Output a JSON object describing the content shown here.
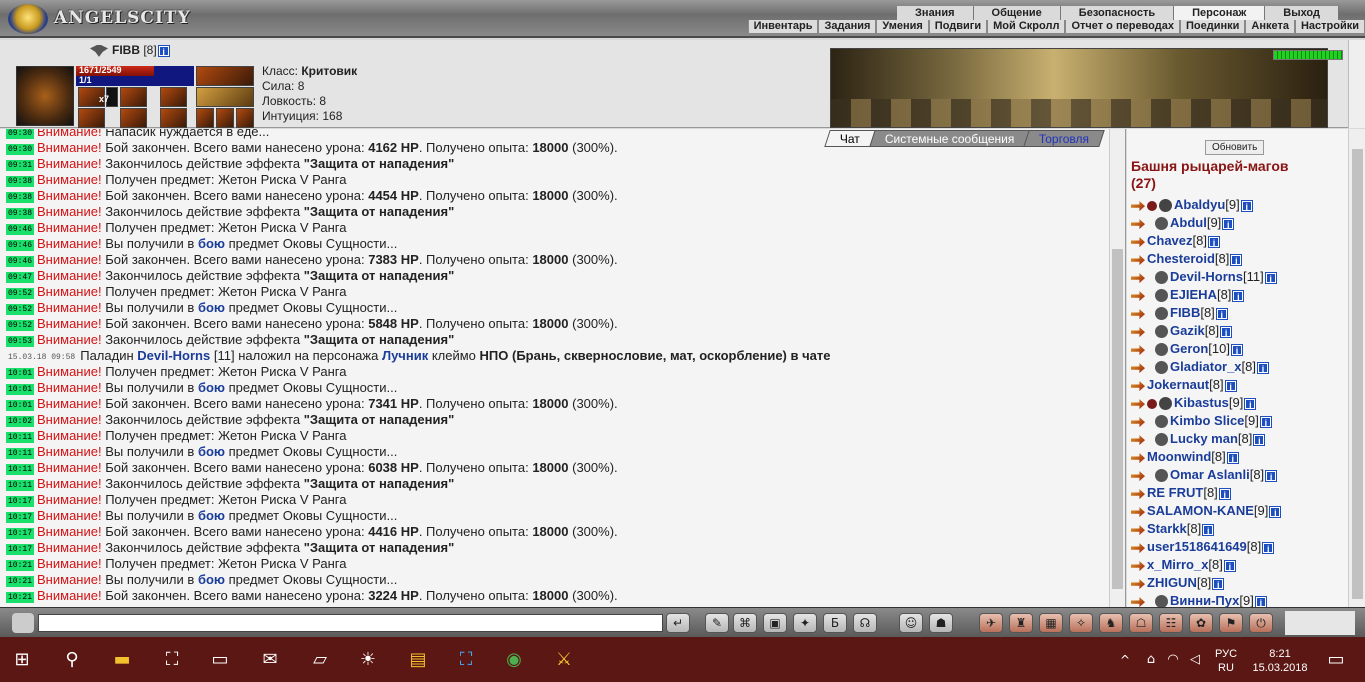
{
  "header": {
    "logo_text": "ANGELSCITY",
    "main_menu": [
      "Знания",
      "Общение",
      "Безопасность",
      "Персонаж",
      "Выход"
    ],
    "active_main": 3,
    "sub_menu": [
      "Инвентарь",
      "Задания",
      "Умения",
      "Подвиги",
      "Мой Скролл",
      "Отчет о переводах",
      "Поединки",
      "Анкета",
      "Настройки"
    ]
  },
  "character": {
    "name": "FIBB",
    "level": "[8]",
    "hp": "1671/2549",
    "mana": "1/1",
    "inv_count": "x7",
    "class_label": "Класс:",
    "class_value": "Критовик",
    "strength_label": "Сила:",
    "strength_value": "8",
    "agility_label": "Ловкость:",
    "agility_value": "8",
    "intuition_label": "Интуиция:",
    "intuition_value": "168",
    "hp_fraction": 0.66
  },
  "chat": {
    "tabs": [
      "Чат",
      "Системные сообщения",
      "Торговля"
    ],
    "lines": [
      {
        "time": "09:30",
        "kind": "warn",
        "pre": "Напасик нуждается в еде..."
      },
      {
        "time": "09:30",
        "kind": "battle",
        "damage": "4162 НР",
        "exp": "18000",
        "pct": "(300%)."
      },
      {
        "time": "09:31",
        "kind": "effect",
        "effect": "\"Защита от нападения\""
      },
      {
        "time": "09:38",
        "kind": "item",
        "item": "Жетон Риска V Ранга"
      },
      {
        "time": "09:38",
        "kind": "battle",
        "damage": "4454 НР",
        "exp": "18000",
        "pct": "(300%)."
      },
      {
        "time": "09:38",
        "kind": "effect",
        "effect": "\"Защита от нападения\""
      },
      {
        "time": "09:46",
        "kind": "item",
        "item": "Жетон Риска V Ранга"
      },
      {
        "time": "09:46",
        "kind": "fight",
        "item": "Оковы Сущности..."
      },
      {
        "time": "09:46",
        "kind": "battle",
        "damage": "7383 НР",
        "exp": "18000",
        "pct": "(300%)."
      },
      {
        "time": "09:47",
        "kind": "effect",
        "effect": "\"Защита от нападения\""
      },
      {
        "time": "09:52",
        "kind": "item",
        "item": "Жетон Риска V Ранга"
      },
      {
        "time": "09:52",
        "kind": "fight",
        "item": "Оковы Сущности..."
      },
      {
        "time": "09:52",
        "kind": "battle",
        "damage": "5848 НР",
        "exp": "18000",
        "pct": "(300%)."
      },
      {
        "time": "09:53",
        "kind": "effect",
        "effect": "\"Защита от нападения\""
      },
      {
        "time": "15.03.18 09:58",
        "kind": "system",
        "text1": "Паладин",
        "who1": "Devil-Horns",
        "lvl1": "[11]",
        "text2": "наложил на персонажа",
        "who2": "Лучник",
        "text3": "клеймо",
        "brand": "НПО (Брань, сквернословие, мат, оскорбление) в чате"
      },
      {
        "time": "10:01",
        "kind": "item",
        "item": "Жетон Риска V Ранга"
      },
      {
        "time": "10:01",
        "kind": "fight",
        "item": "Оковы Сущности..."
      },
      {
        "time": "10:01",
        "kind": "battle",
        "damage": "7341 НР",
        "exp": "18000",
        "pct": "(300%)."
      },
      {
        "time": "10:02",
        "kind": "effect",
        "effect": "\"Защита от нападения\""
      },
      {
        "time": "10:11",
        "kind": "item",
        "item": "Жетон Риска V Ранга"
      },
      {
        "time": "10:11",
        "kind": "fight",
        "item": "Оковы Сущности..."
      },
      {
        "time": "10:11",
        "kind": "battle",
        "damage": "6038 НР",
        "exp": "18000",
        "pct": "(300%)."
      },
      {
        "time": "10:11",
        "kind": "effect",
        "effect": "\"Защита от нападения\""
      },
      {
        "time": "10:17",
        "kind": "item",
        "item": "Жетон Риска V Ранга"
      },
      {
        "time": "10:17",
        "kind": "fight",
        "item": "Оковы Сущности..."
      },
      {
        "time": "10:17",
        "kind": "battle",
        "damage": "4416 НР",
        "exp": "18000",
        "pct": "(300%)."
      },
      {
        "time": "10:17",
        "kind": "effect",
        "effect": "\"Защита от нападения\""
      },
      {
        "time": "10:21",
        "kind": "item",
        "item": "Жетон Риска V Ранга"
      },
      {
        "time": "10:21",
        "kind": "fight",
        "item": "Оковы Сущности..."
      },
      {
        "time": "10:21",
        "kind": "battle",
        "damage": "3224 НР",
        "exp": "18000",
        "pct": "(300%)."
      }
    ],
    "strings": {
      "warn": "Внимание!",
      "battle_a": "Бой закончен. Всего вами нанесено урона:",
      "battle_b": ". Получено опыта:",
      "effect_a": "Закончилось действие эффекта",
      "item_a": "Получен предмет:",
      "fight_a": "Вы получили в",
      "fight_word": "бою",
      "fight_b": "предмет"
    }
  },
  "sidebar": {
    "refresh_label": "Обновить",
    "room_name": "Башня рыцарей-магов",
    "room_count": "(27)",
    "users": [
      {
        "name": "Abaldyu",
        "lvl": "[9]",
        "indent": 1
      },
      {
        "name": "Abdul",
        "lvl": "[9]",
        "indent": 2
      },
      {
        "name": "Chavez",
        "lvl": "[8]",
        "indent": 0
      },
      {
        "name": "Chesteroid",
        "lvl": "[8]",
        "indent": 0
      },
      {
        "name": "Devil-Horns",
        "lvl": "[11]",
        "indent": 2
      },
      {
        "name": "EJIEHA",
        "lvl": "[8]",
        "indent": 2
      },
      {
        "name": "FIBB",
        "lvl": "[8]",
        "indent": 2
      },
      {
        "name": "Gazik",
        "lvl": "[8]",
        "indent": 2
      },
      {
        "name": "Geron",
        "lvl": "[10]",
        "indent": 2
      },
      {
        "name": "Gladiator_x",
        "lvl": "[8]",
        "indent": 2
      },
      {
        "name": "Jokernaut",
        "lvl": "[8]",
        "indent": 0
      },
      {
        "name": "Kibastus",
        "lvl": "[9]",
        "indent": 1
      },
      {
        "name": "Kimbo Slice",
        "lvl": "[9]",
        "indent": 2
      },
      {
        "name": "Lucky man",
        "lvl": "[8]",
        "indent": 2
      },
      {
        "name": "Moonwind",
        "lvl": "[8]",
        "indent": 0
      },
      {
        "name": "Omar Aslanli",
        "lvl": "[8]",
        "indent": 2
      },
      {
        "name": "RE FRUT",
        "lvl": "[8]",
        "indent": 0
      },
      {
        "name": "SALAMON-KANE",
        "lvl": "[9]",
        "indent": 0
      },
      {
        "name": "Starkk",
        "lvl": "[8]",
        "indent": 0
      },
      {
        "name": "user1518641649",
        "lvl": "[8]",
        "indent": 0
      },
      {
        "name": "x_Mirro_x",
        "lvl": "[8]",
        "indent": 0
      },
      {
        "name": "ZHIGUN",
        "lvl": "[8]",
        "indent": 0
      },
      {
        "name": "Винни-Пух",
        "lvl": "[9]",
        "indent": 2
      }
    ]
  },
  "bottom": {
    "input_value": ""
  },
  "taskbar": {
    "lang_top": "РУС",
    "lang_bottom": "RU",
    "time": "8:21",
    "date": "15.03.2018"
  }
}
